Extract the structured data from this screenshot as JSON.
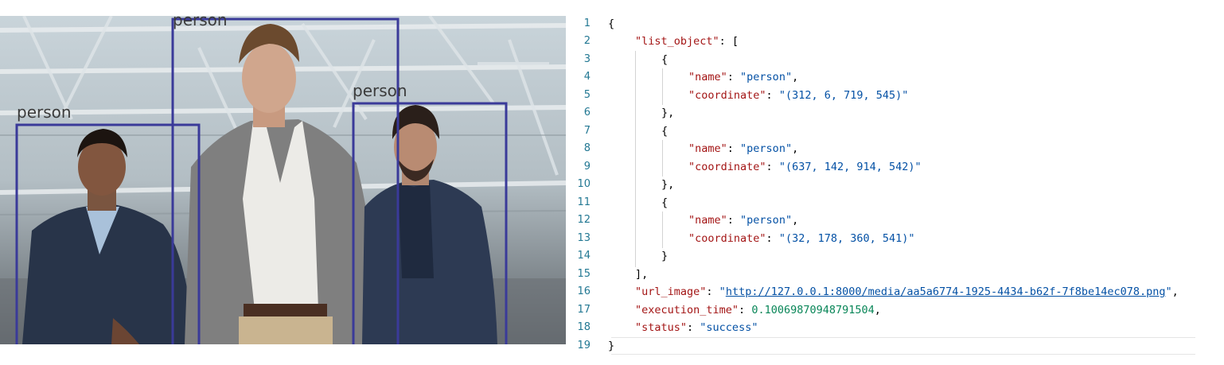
{
  "detection_image": {
    "labels": [
      "person",
      "person",
      "person"
    ],
    "box_color": "#3a3a99",
    "label_color": "#3b3b3b"
  },
  "editor": {
    "line_numbers": [
      "1",
      "2",
      "3",
      "4",
      "5",
      "6",
      "7",
      "8",
      "9",
      "10",
      "11",
      "12",
      "13",
      "14",
      "15",
      "16",
      "17",
      "18",
      "19"
    ],
    "keys": {
      "list_object": "\"list_object\"",
      "name": "\"name\"",
      "coordinate": "\"coordinate\"",
      "url_image": "\"url_image\"",
      "execution_time": "\"execution_time\"",
      "status": "\"status\""
    },
    "objects": [
      {
        "name": "\"person\"",
        "coordinate": "\"(312, 6, 719, 545)\""
      },
      {
        "name": "\"person\"",
        "coordinate": "\"(637, 142, 914, 542)\""
      },
      {
        "name": "\"person\"",
        "coordinate": "\"(32, 178, 360, 541)\""
      }
    ],
    "url_image": "http://127.0.0.1:8000/media/aa5a6774-1925-4434-b62f-7f8be14ec078.png",
    "execution_time": "0.10069870948791504",
    "status": "\"success\"",
    "colors": {
      "key": "#a31515",
      "string": "#0451a5",
      "number": "#098658",
      "line_number": "#237893"
    }
  }
}
